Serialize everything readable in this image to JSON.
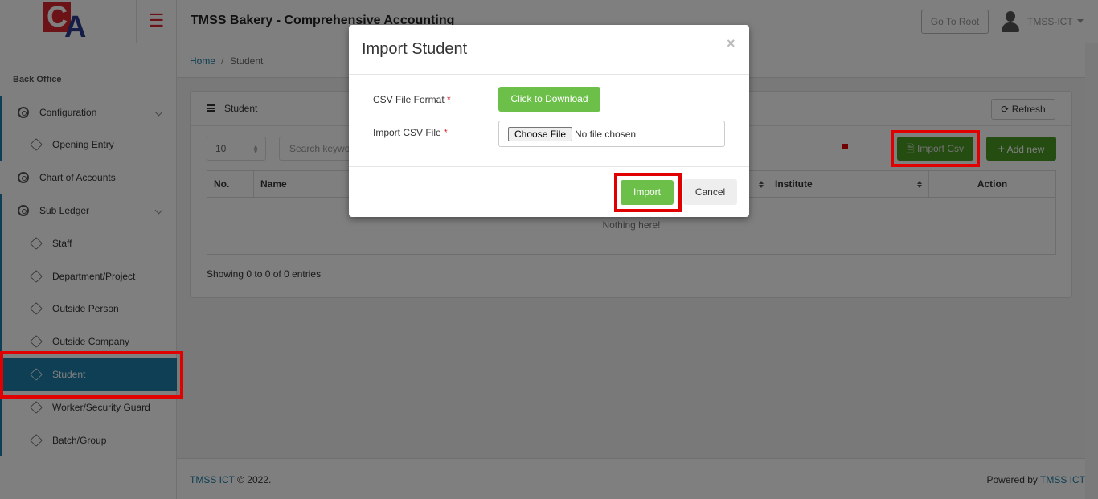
{
  "topbar": {
    "app_title": "TMSS Bakery - Comprehensive Accounting",
    "go_root_label": "Go To Root",
    "user_name": "TMSS-ICT",
    "logo_letter_c": "C",
    "logo_letter_a": "A"
  },
  "sidebar": {
    "section_header": "Back Office",
    "items": [
      {
        "label": "Configuration",
        "icon": "gear-icon",
        "expandable": true
      },
      {
        "label": "Opening Entry",
        "icon": "cube-icon"
      },
      {
        "label": "Chart of Accounts",
        "icon": "gear-icon"
      },
      {
        "label": "Sub Ledger",
        "icon": "gear-icon",
        "expandable": true
      },
      {
        "label": "Staff",
        "icon": "cube-icon"
      },
      {
        "label": "Department/Project",
        "icon": "cube-icon"
      },
      {
        "label": "Outside Person",
        "icon": "cube-icon"
      },
      {
        "label": "Outside Company",
        "icon": "cube-icon"
      },
      {
        "label": "Student",
        "icon": "cube-icon",
        "active": true
      },
      {
        "label": "Worker/Security Guard",
        "icon": "cube-icon"
      },
      {
        "label": "Batch/Group",
        "icon": "cube-icon"
      }
    ]
  },
  "breadcrumb": {
    "home": "Home",
    "separator": "/",
    "current": "Student"
  },
  "panel": {
    "title": "Student",
    "refresh_label": "Refresh",
    "page_size": "10",
    "search_placeholder": "Search keyword",
    "import_csv_label": "Import Csv",
    "add_new_label": "Add new",
    "columns": [
      "No.",
      "Name",
      "Institute",
      "Action"
    ],
    "empty_message": "Nothing here!",
    "showing_text": "Showing 0 to 0 of 0 entries"
  },
  "footer": {
    "left_link": "TMSS ICT",
    "left_text": "© 2022.",
    "right_text": "Powered by",
    "right_link": "TMSS ICT"
  },
  "modal": {
    "title": "Import Student",
    "close_symbol": "×",
    "csv_format_label": "CSV File Format",
    "required_mark": "*",
    "download_label": "Click to Download",
    "import_file_label": "Import CSV File",
    "choose_file_label": "Choose File",
    "no_file_text": "No file chosen",
    "import_label": "Import",
    "cancel_label": "Cancel"
  },
  "colors": {
    "accent": "#1e7ea8",
    "success": "#6cc04a",
    "brand_red": "#d6262d",
    "highlight": "#e00000"
  }
}
